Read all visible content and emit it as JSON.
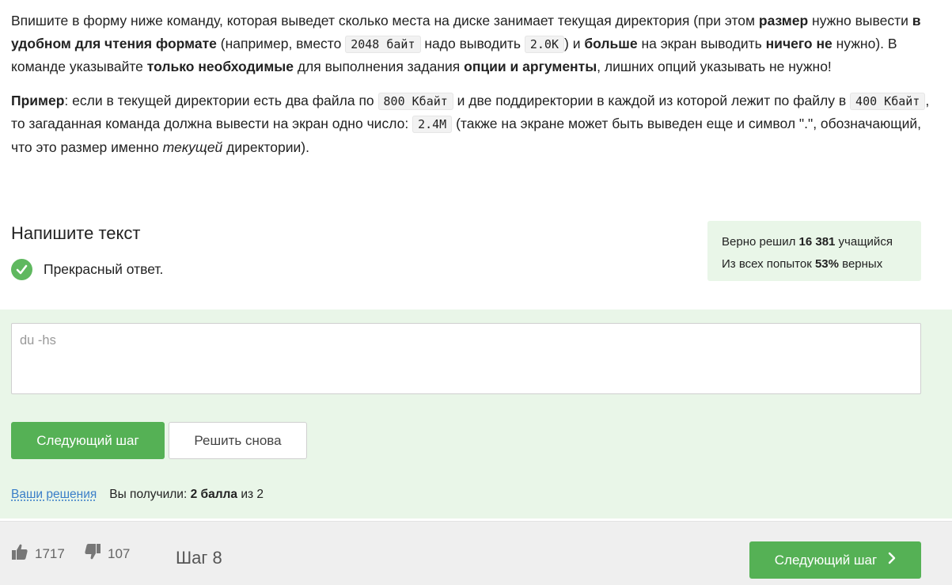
{
  "problem": {
    "p1": {
      "t1": "Впишите в форму ниже команду, которая выведет сколько места на диске занимает текущая директория (при этом ",
      "b1": "размер",
      "t2": " нужно вывести ",
      "b2": "в удобном для чтения формате",
      "t3": " (например, вместо ",
      "c1": "2048 байт",
      "t4": " надо выводить ",
      "c2": "2.0K",
      "t5": ") и ",
      "b3": "больше",
      "t6": " на экран выводить ",
      "b4": "ничего не",
      "t7": " нужно). В команде указывайте ",
      "b5": "только необходимые",
      "t8": " для выполнения задания ",
      "b6": "опции и аргументы",
      "t9": ", лишних опций указывать не нужно!"
    },
    "p2": {
      "b1": "Пример",
      "t1": ": если в текущей директории есть два файла по ",
      "c1": "800 Кбайт",
      "t2": " и две поддиректории в каждой из которой лежит по файлу в ",
      "c2": "400 Кбайт",
      "t3": ", то загаданная команда должна вывести на экран одно число: ",
      "c3": "2.4M",
      "t4": " (также на экране может быть выведен еще и символ \".\", обозначающий, что это размер именно ",
      "i1": "текущей",
      "t5": " директории)."
    }
  },
  "section_title": "Напишите текст",
  "feedback": "Прекрасный ответ.",
  "stats": {
    "line1_prefix": "Верно решил ",
    "line1_value": "16 381",
    "line1_suffix": " учащийся",
    "line2_prefix": "Из всех попыток ",
    "line2_value": "53%",
    "line2_suffix": " верных"
  },
  "answer": {
    "value": "du -hs"
  },
  "buttons": {
    "next_step": "Следующий шаг",
    "retry": "Решить снова"
  },
  "solutions": {
    "link": "Ваши решения",
    "received_prefix": "Вы получили: ",
    "received_value": "2 балла",
    "received_suffix": " из 2"
  },
  "bottom": {
    "likes": "1717",
    "dislikes": "107",
    "step": "Шаг 8",
    "next_step": "Следующий шаг"
  },
  "colors": {
    "accent_green": "#55b155",
    "success_bg": "#e9f6e8",
    "link_blue": "#3a7ec8"
  }
}
